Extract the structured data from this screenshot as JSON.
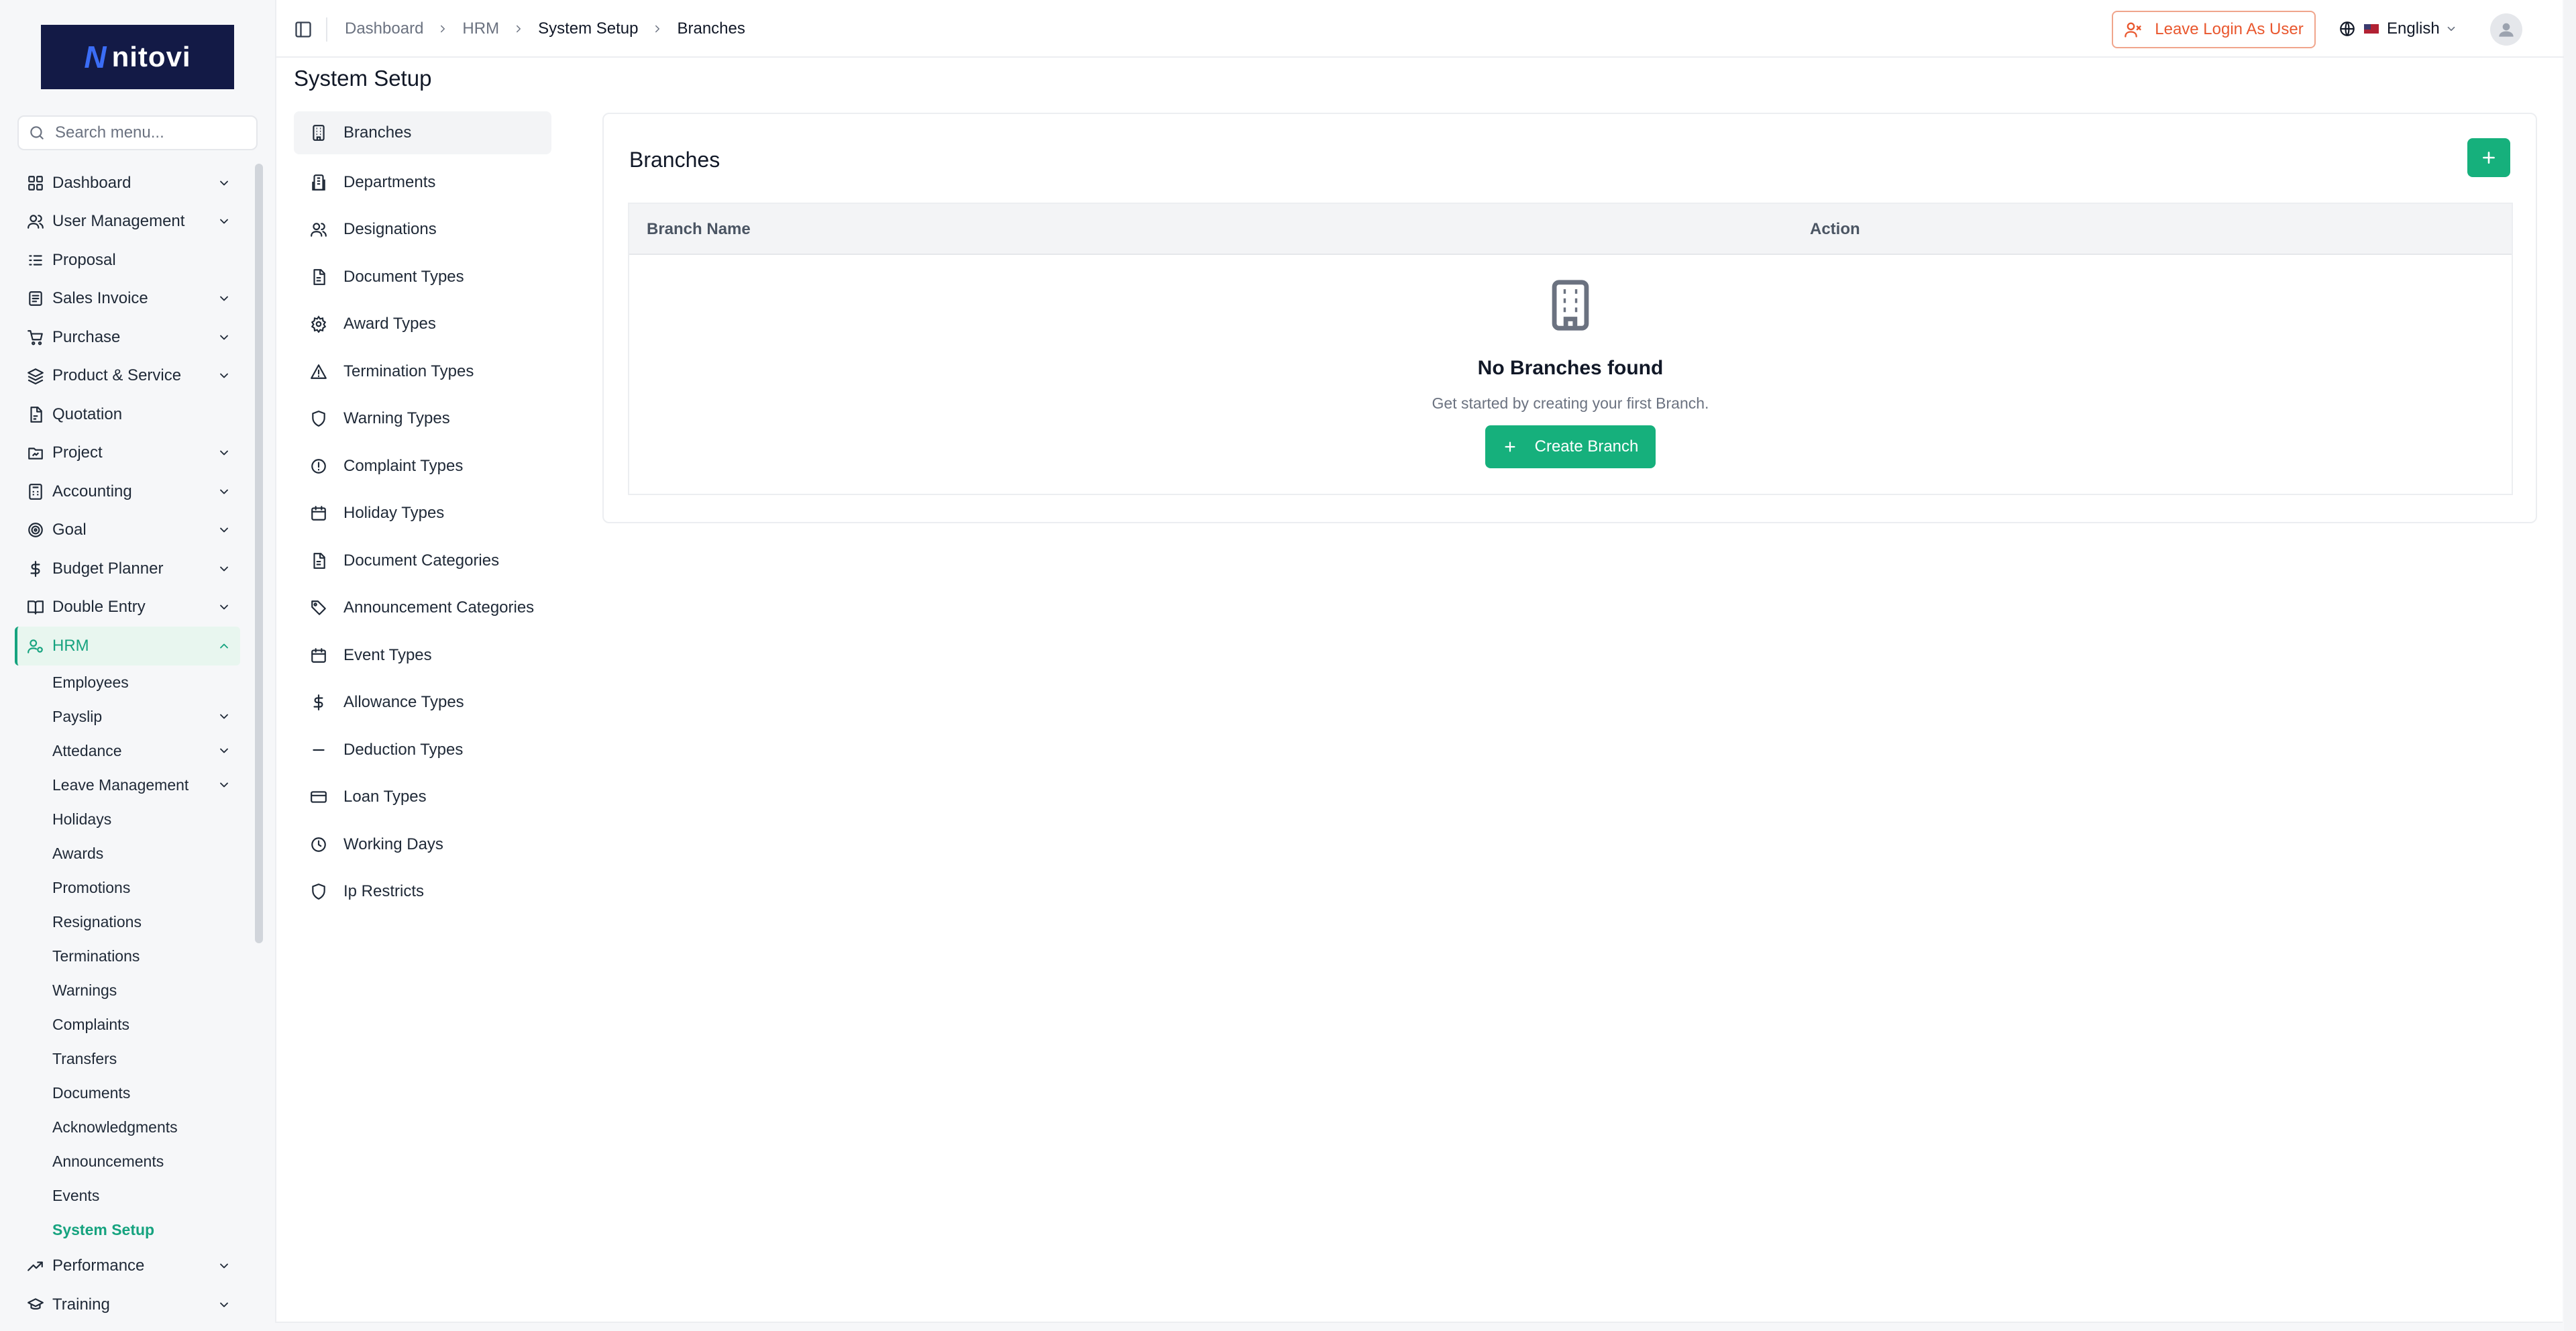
{
  "brand": {
    "mark": "N",
    "name": "nitovi"
  },
  "search": {
    "placeholder": "Search menu..."
  },
  "sidebar": {
    "items": [
      {
        "label": "Dashboard",
        "icon": "grid-icon",
        "chevron": true
      },
      {
        "label": "User Management",
        "icon": "users-icon",
        "chevron": true
      },
      {
        "label": "Proposal",
        "icon": "proposal-icon",
        "chevron": false
      },
      {
        "label": "Sales Invoice",
        "icon": "invoice-icon",
        "chevron": true
      },
      {
        "label": "Purchase",
        "icon": "cart-icon",
        "chevron": true
      },
      {
        "label": "Product & Service",
        "icon": "layers-icon",
        "chevron": true
      },
      {
        "label": "Quotation",
        "icon": "quotation-icon",
        "chevron": false
      },
      {
        "label": "Project",
        "icon": "folder-icon",
        "chevron": true
      },
      {
        "label": "Accounting",
        "icon": "calculator-icon",
        "chevron": true
      },
      {
        "label": "Goal",
        "icon": "target-icon",
        "chevron": true
      },
      {
        "label": "Budget Planner",
        "icon": "dollar-icon",
        "chevron": true
      },
      {
        "label": "Double Entry",
        "icon": "book-icon",
        "chevron": true
      },
      {
        "label": "HRM",
        "icon": "user-cog-icon",
        "chevron": true
      }
    ],
    "hrm_sub": [
      {
        "label": "Employees",
        "chevron": false
      },
      {
        "label": "Payslip",
        "chevron": true
      },
      {
        "label": "Attedance",
        "chevron": true
      },
      {
        "label": "Leave Management",
        "chevron": true
      },
      {
        "label": "Holidays",
        "chevron": false
      },
      {
        "label": "Awards",
        "chevron": false
      },
      {
        "label": "Promotions",
        "chevron": false
      },
      {
        "label": "Resignations",
        "chevron": false
      },
      {
        "label": "Terminations",
        "chevron": false
      },
      {
        "label": "Warnings",
        "chevron": false
      },
      {
        "label": "Complaints",
        "chevron": false
      },
      {
        "label": "Transfers",
        "chevron": false
      },
      {
        "label": "Documents",
        "chevron": false
      },
      {
        "label": "Acknowledgments",
        "chevron": false
      },
      {
        "label": "Announcements",
        "chevron": false
      },
      {
        "label": "Events",
        "chevron": false
      },
      {
        "label": "System Setup",
        "chevron": false
      }
    ],
    "after": [
      {
        "label": "Performance",
        "icon": "trending-icon",
        "chevron": true
      },
      {
        "label": "Training",
        "icon": "graduation-icon",
        "chevron": true
      }
    ]
  },
  "header": {
    "breadcrumbs": [
      "Dashboard",
      "HRM",
      "System Setup",
      "Branches"
    ],
    "leave_login": "Leave Login As User",
    "language": "English"
  },
  "page": {
    "title": "System Setup"
  },
  "setup_nav": [
    {
      "label": "Branches",
      "icon": "building-icon"
    },
    {
      "label": "Departments",
      "icon": "building-2-icon"
    },
    {
      "label": "Designations",
      "icon": "users-icon"
    },
    {
      "label": "Document Types",
      "icon": "file-text-icon"
    },
    {
      "label": "Award Types",
      "icon": "gear-icon"
    },
    {
      "label": "Termination Types",
      "icon": "warning-triangle-icon"
    },
    {
      "label": "Warning Types",
      "icon": "shield-icon"
    },
    {
      "label": "Complaint Types",
      "icon": "alert-circle-icon"
    },
    {
      "label": "Holiday Types",
      "icon": "calendar-icon"
    },
    {
      "label": "Document Categories",
      "icon": "file-text-icon"
    },
    {
      "label": "Announcement Categories",
      "icon": "tag-icon"
    },
    {
      "label": "Event Types",
      "icon": "calendar-icon"
    },
    {
      "label": "Allowance Types",
      "icon": "dollar-icon"
    },
    {
      "label": "Deduction Types",
      "icon": "minus-icon"
    },
    {
      "label": "Loan Types",
      "icon": "credit-card-icon"
    },
    {
      "label": "Working Days",
      "icon": "clock-icon"
    },
    {
      "label": "Ip Restricts",
      "icon": "shield-icon"
    }
  ],
  "branches": {
    "title": "Branches",
    "columns": [
      "Branch Name",
      "Action"
    ],
    "empty_title": "No Branches found",
    "empty_subtitle": "Get started by creating your first Branch.",
    "create_label": "Create Branch"
  },
  "colors": {
    "accent": "#16b07c",
    "active_text": "#16a37f",
    "danger": "#e9572e"
  }
}
